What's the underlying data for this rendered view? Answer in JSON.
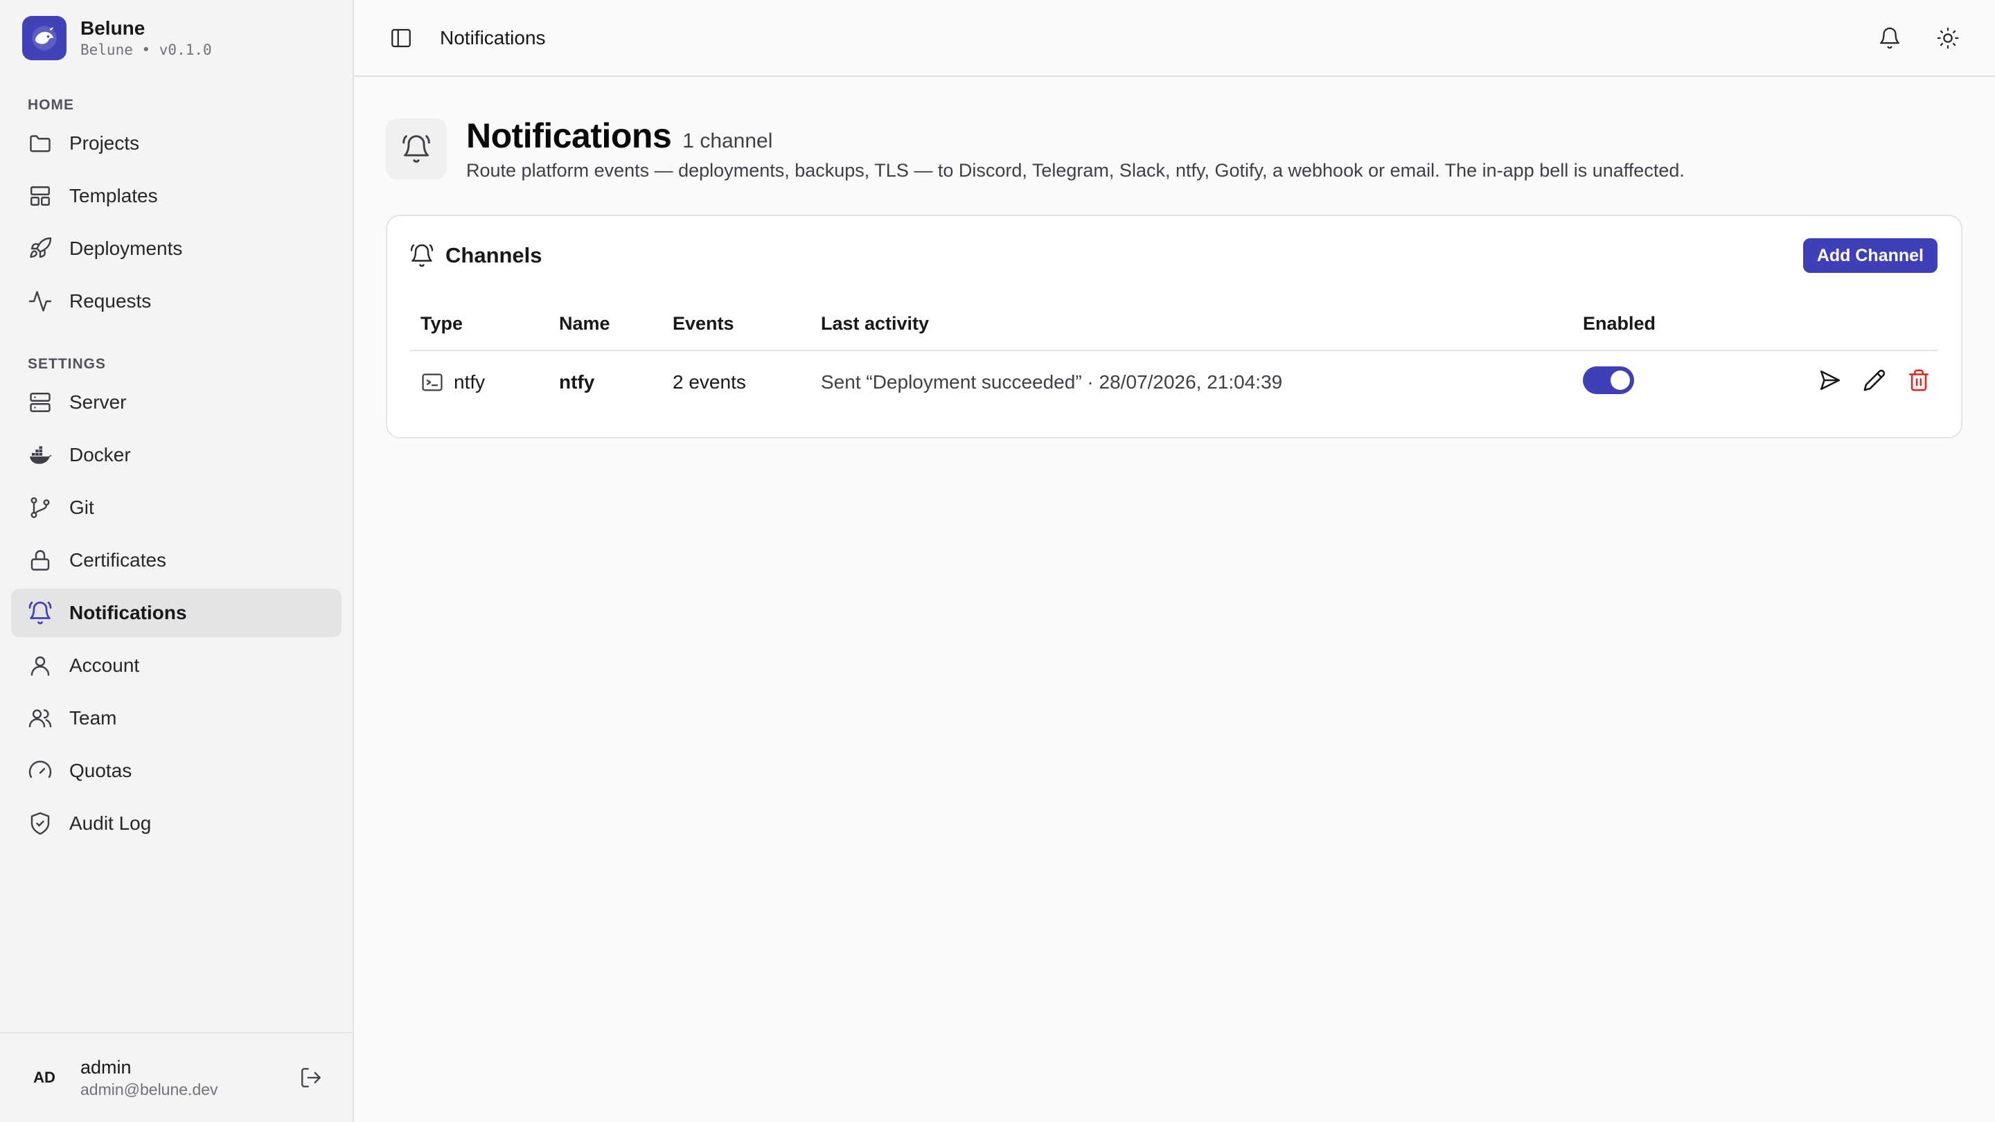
{
  "brand": {
    "name": "Belune",
    "sub": "Belune • v0.1.0"
  },
  "sidebar": {
    "home_label": "HOME",
    "settings_label": "SETTINGS",
    "home_items": [
      {
        "label": "Projects",
        "icon": "folder-icon"
      },
      {
        "label": "Templates",
        "icon": "layout-icon"
      },
      {
        "label": "Deployments",
        "icon": "rocket-icon"
      },
      {
        "label": "Requests",
        "icon": "activity-icon"
      }
    ],
    "settings_items": [
      {
        "label": "Server",
        "icon": "server-icon"
      },
      {
        "label": "Docker",
        "icon": "docker-icon"
      },
      {
        "label": "Git",
        "icon": "git-branch-icon"
      },
      {
        "label": "Certificates",
        "icon": "lock-icon"
      },
      {
        "label": "Notifications",
        "icon": "bell-icon",
        "active": true
      },
      {
        "label": "Account",
        "icon": "user-icon"
      },
      {
        "label": "Team",
        "icon": "users-icon"
      },
      {
        "label": "Quotas",
        "icon": "gauge-icon"
      },
      {
        "label": "Audit Log",
        "icon": "shield-check-icon"
      }
    ]
  },
  "user": {
    "initials": "AD",
    "name": "admin",
    "email": "admin@belune.dev"
  },
  "topbar": {
    "breadcrumb": "Notifications"
  },
  "page": {
    "title": "Notifications",
    "count": "1 channel",
    "description": "Route platform events — deployments, backups, TLS — to Discord, Telegram, Slack, ntfy, Gotify, a webhook or email. The in-app bell is unaffected."
  },
  "channels": {
    "title": "Channels",
    "add_label": "Add Channel",
    "columns": [
      "Type",
      "Name",
      "Events",
      "Last activity",
      "Enabled"
    ],
    "rows": [
      {
        "type": "ntfy",
        "name": "ntfy",
        "events": "2 events",
        "last_activity": "Sent “Deployment succeeded” · 28/07/2026, 21:04:39",
        "enabled": true
      }
    ]
  },
  "colors": {
    "accent": "#3f3fb8",
    "danger": "#dc2626",
    "sidebar_bg": "#f4f4f5"
  }
}
